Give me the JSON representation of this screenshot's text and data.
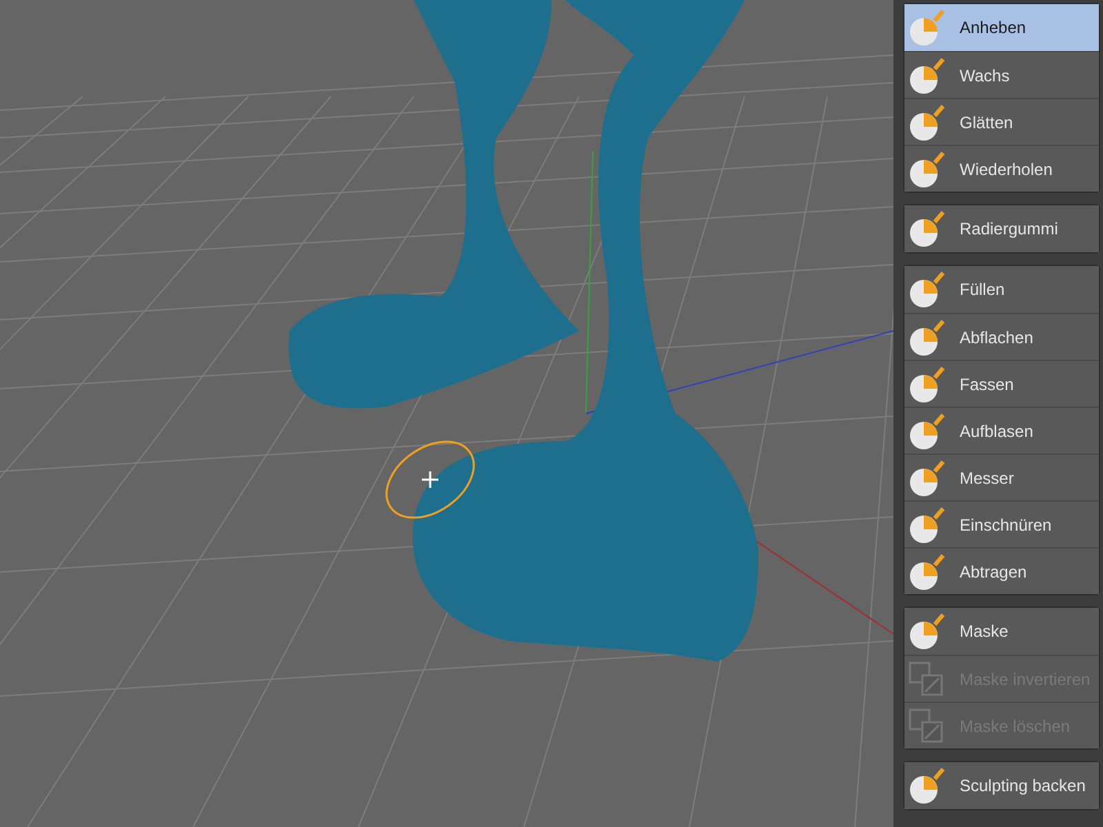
{
  "tool_groups": [
    {
      "tools": [
        {
          "label": "Anheben",
          "selected": true,
          "disabled": false
        },
        {
          "label": "Wachs",
          "selected": false,
          "disabled": false
        },
        {
          "label": "Glätten",
          "selected": false,
          "disabled": false
        },
        {
          "label": "Wiederholen",
          "selected": false,
          "disabled": false
        }
      ]
    },
    {
      "tools": [
        {
          "label": "Radiergummi",
          "selected": false,
          "disabled": false
        }
      ]
    },
    {
      "tools": [
        {
          "label": "Füllen",
          "selected": false,
          "disabled": false
        },
        {
          "label": "Abflachen",
          "selected": false,
          "disabled": false
        },
        {
          "label": "Fassen",
          "selected": false,
          "disabled": false
        },
        {
          "label": "Aufblasen",
          "selected": false,
          "disabled": false
        },
        {
          "label": "Messer",
          "selected": false,
          "disabled": false
        },
        {
          "label": "Einschnüren",
          "selected": false,
          "disabled": false
        },
        {
          "label": "Abtragen",
          "selected": false,
          "disabled": false
        }
      ]
    },
    {
      "tools": [
        {
          "label": "Maske",
          "selected": false,
          "disabled": false
        },
        {
          "label": "Maske invertieren",
          "selected": false,
          "disabled": true
        },
        {
          "label": "Maske löschen",
          "selected": false,
          "disabled": true
        }
      ]
    },
    {
      "tools": [
        {
          "label": "Sculpting backen",
          "selected": false,
          "disabled": false
        }
      ]
    }
  ]
}
